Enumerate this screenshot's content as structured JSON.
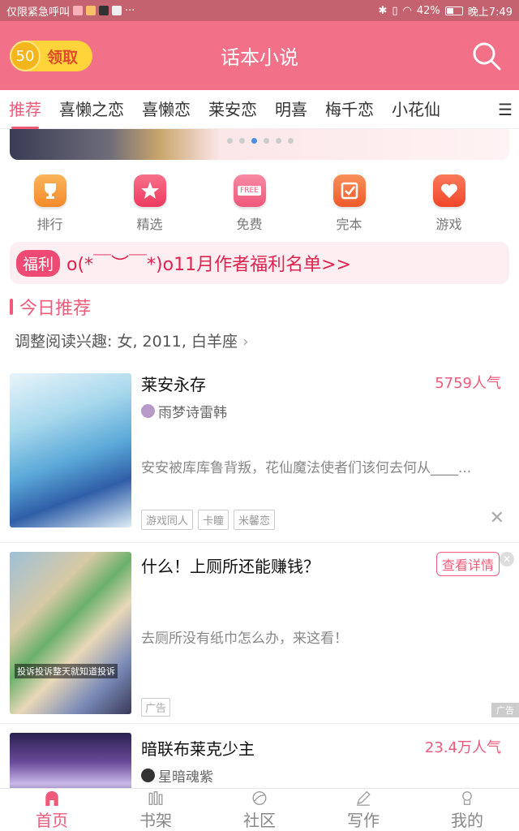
{
  "status_bar": {
    "carrier_text": "仅限紧急呼叫",
    "battery": "42%",
    "time": "晚上7:49"
  },
  "header": {
    "title": "话本小说",
    "coin_value": "50",
    "coin_label": "领取"
  },
  "tabs": [
    {
      "label": "推荐",
      "active": true
    },
    {
      "label": "喜懒之恋"
    },
    {
      "label": "喜懒恋"
    },
    {
      "label": "莱安恋"
    },
    {
      "label": "明喜"
    },
    {
      "label": "梅千恋"
    },
    {
      "label": "小花仙"
    }
  ],
  "quick_nav": [
    {
      "label": "排行",
      "icon": "trophy-icon",
      "color": "#f7913a"
    },
    {
      "label": "精选",
      "icon": "star-icon",
      "color": "#f04a6a"
    },
    {
      "label": "免费",
      "icon": "free-icon",
      "color": "#f26b8a",
      "badge": "FREE"
    },
    {
      "label": "完本",
      "icon": "check-icon",
      "color": "#f26b3a"
    },
    {
      "label": "游戏",
      "icon": "heart-icon",
      "color": "#f4593a"
    }
  ],
  "welfare": {
    "tag": "福利",
    "text": "o(*￣︶￣*)o11月作者福利名单>>"
  },
  "section": {
    "title": "今日推荐",
    "interest": "调整阅读兴趣: 女, 2011, 白羊座"
  },
  "books": [
    {
      "title": "莱安永存",
      "popularity": "5759人气",
      "author": "雨梦诗雷韩",
      "desc": "安安被库库鲁背叛，花仙魔法使者们该何去何从____...",
      "tags": [
        "游戏同人",
        "卡瞳",
        "米馨恋"
      ]
    },
    {
      "title": "暗联布莱克少主",
      "popularity": "23.4万人气",
      "author": "星暗魂紫"
    }
  ],
  "ad": {
    "title": "什么！上厕所还能赚钱？",
    "button": "查看详情",
    "desc": "去厕所没有纸巾怎么办，来这看！",
    "tag": "广告",
    "corner": "广告",
    "image_caption": "投诉投诉整天就知道投诉"
  },
  "bottom_nav": [
    {
      "label": "首页",
      "icon": "home-icon",
      "active": true
    },
    {
      "label": "书架",
      "icon": "bookshelf-icon"
    },
    {
      "label": "社区",
      "icon": "community-icon"
    },
    {
      "label": "写作",
      "icon": "pen-icon"
    },
    {
      "label": "我的",
      "icon": "profile-icon"
    }
  ],
  "colors": {
    "accent": "#f05a7a",
    "header_bg": "#f27088"
  }
}
